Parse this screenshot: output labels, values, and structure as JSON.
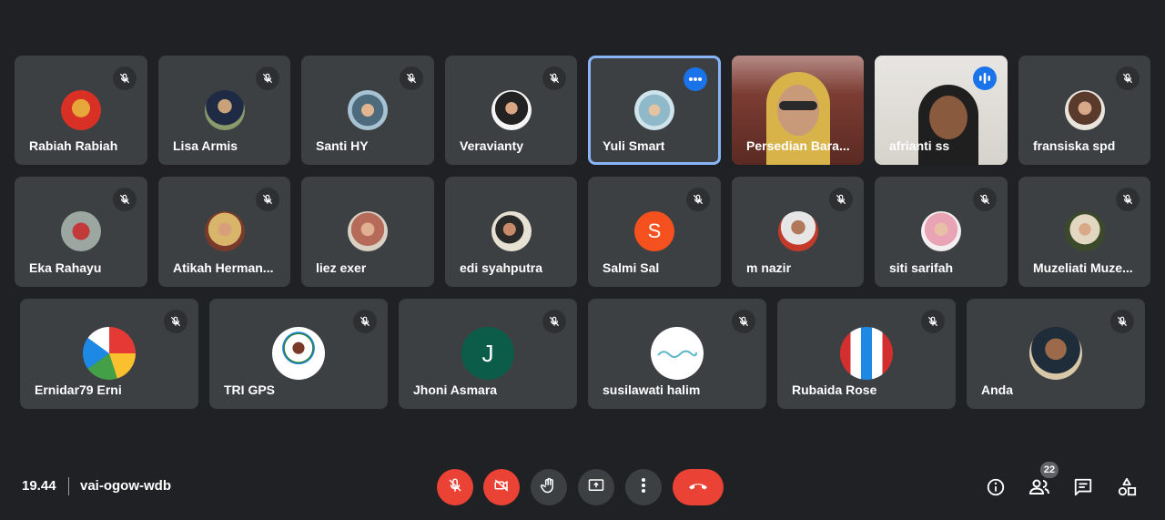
{
  "participants": [
    {
      "name": "Rabiah Rabiah",
      "muted": true
    },
    {
      "name": "Lisa Armis",
      "muted": true
    },
    {
      "name": "Santi HY",
      "muted": true
    },
    {
      "name": "Veravianty",
      "muted": true
    },
    {
      "name": "Yuli Smart",
      "muted": false,
      "active": true
    },
    {
      "name": "Persedian Bara...",
      "muted": false
    },
    {
      "name": "afrianti ss",
      "muted": false,
      "speaking": true
    },
    {
      "name": "fransiska spd",
      "muted": true
    },
    {
      "name": "Eka Rahayu",
      "muted": true
    },
    {
      "name": "Atikah Herman...",
      "muted": true
    },
    {
      "name": "liez exer",
      "muted": false
    },
    {
      "name": "edi syahputra",
      "muted": false
    },
    {
      "name": "Salmi Sal",
      "muted": true,
      "initial": "S"
    },
    {
      "name": "m nazir",
      "muted": true
    },
    {
      "name": "siti sarifah",
      "muted": true
    },
    {
      "name": "Muzeliati Muze...",
      "muted": true
    },
    {
      "name": "Ernidar79 Erni",
      "muted": true
    },
    {
      "name": "TRI GPS",
      "muted": true
    },
    {
      "name": "Jhoni Asmara",
      "muted": true,
      "initial": "J"
    },
    {
      "name": "susilawati halim",
      "muted": true
    },
    {
      "name": "Rubaida Rose",
      "muted": true
    },
    {
      "name": "Anda",
      "muted": true
    }
  ],
  "meeting": {
    "time": "19.44",
    "code": "vai-ogow-wdb",
    "participant_count": "22"
  },
  "colors": {
    "background": "#202124",
    "tile": "#3c4043",
    "danger": "#ea4335",
    "accent": "#1a73e8"
  },
  "icons": {
    "mic_off": "mic-off-icon",
    "cam_off": "camera-off-icon",
    "raise_hand": "hand-icon",
    "present": "present-icon",
    "more": "more-vert-icon",
    "end_call": "end-call-icon",
    "info": "info-icon",
    "people": "people-icon",
    "chat": "chat-icon",
    "activities": "shapes-icon"
  }
}
